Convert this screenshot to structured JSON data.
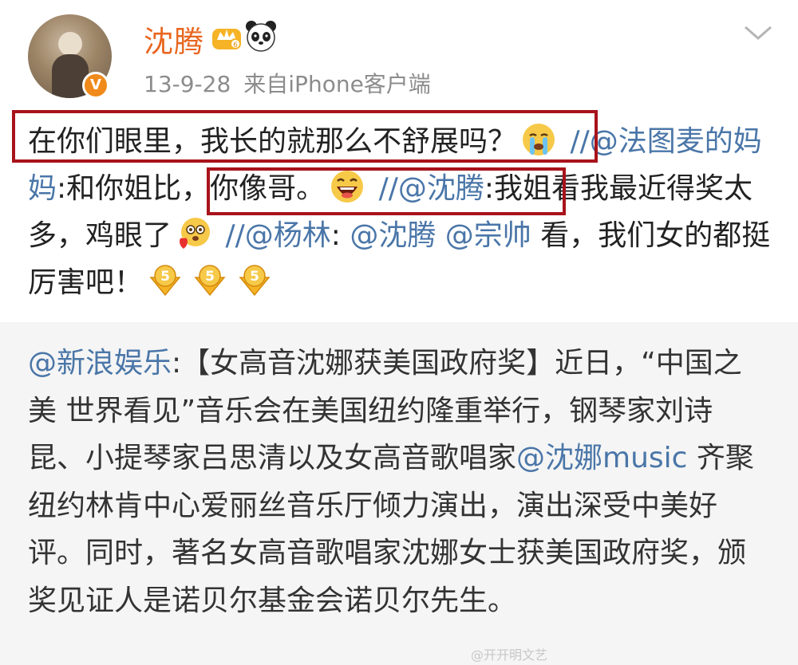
{
  "header": {
    "username": "沈腾",
    "date": "13-9-28",
    "source": "来自iPhone客户端",
    "verified_badge": "V"
  },
  "icons": {
    "avatar": "avatar-photo",
    "crown": "crown-icon",
    "panda": "panda-icon",
    "chevron": "chevron-down-icon",
    "crying": "crying-face-emoji",
    "laughing": "laughing-face-emoji",
    "drool": "drooling-face-emoji",
    "number5": "number-5-badge-icon"
  },
  "colors": {
    "username": "#e8661f",
    "link": "#4a76a8",
    "highlight_box": "#a8131b",
    "repost_bg": "#f5f5f5"
  },
  "post": {
    "line1_text": "在你们眼里，我长的就那么不舒展吗？",
    "sep1": " //",
    "mention1": "@法图麦的妈妈",
    "colon1": ":",
    "text2": "和你姐比，你像哥。",
    "sep2": " //",
    "mention2": "@沈腾",
    "colon2": ":",
    "text3": "我姐看我最近得奖太多，鸡眼了",
    "sep3": " //",
    "mention3": "@杨林",
    "colon3": ": ",
    "mention4": "@沈腾",
    "space": " ",
    "mention5": "@宗帅",
    "text4": " 看，我们女的都挺厉害吧！"
  },
  "repost": {
    "mention": "@新浪娱乐",
    "colon": ":",
    "text1": "【女高音沈娜获美国政府奖】近日，“中国之美 世界看见”音乐会在美国纽约隆重举行，钢琴家刘诗昆、小提琴家吕思清以及女高音歌唱家",
    "mention2": "@沈娜music",
    "text2": " 齐聚纽约林肯中心爱丽丝音乐厅倾力演出，演出深受中美好评。同时，著名女高音歌唱家沈娜女士获美国政府奖，颁奖见证人是诺贝尔基金会诺贝尔先生。"
  },
  "watermark": "@开开明文艺"
}
